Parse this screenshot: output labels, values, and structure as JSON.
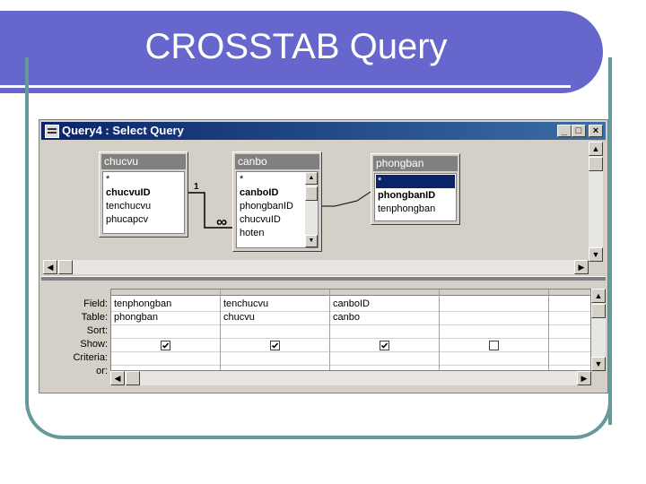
{
  "slide": {
    "title": "CROSSTAB Query"
  },
  "window": {
    "title": "Query4 : Select Query",
    "buttons": {
      "minimize": "_",
      "maximize": "□",
      "close": "×"
    }
  },
  "tables": [
    {
      "name": "chucvu",
      "fields": [
        "*",
        "chucvuID",
        "tenchucvu",
        "phucapcv"
      ],
      "bold_fields": [
        "chucvuID"
      ]
    },
    {
      "name": "canbo",
      "fields": [
        "*",
        "canboID",
        "phongbanID",
        "chucvuID",
        "hoten"
      ],
      "bold_fields": [
        "canboID"
      ]
    },
    {
      "name": "phongban",
      "fields": [
        "*",
        "phongbanID",
        "tenphongban"
      ],
      "bold_fields": [
        "phongbanID"
      ],
      "selected_field": "*"
    }
  ],
  "relationship": {
    "one_side": "1",
    "many_side": "∞"
  },
  "grid": {
    "row_labels": [
      "Field:",
      "Table:",
      "Sort:",
      "Show:",
      "Criteria:",
      "or:"
    ],
    "columns": [
      {
        "field": "tenphongban",
        "table": "phongban",
        "sort": "",
        "show": true,
        "criteria": ""
      },
      {
        "field": "tenchucvu",
        "table": "chucvu",
        "sort": "",
        "show": true,
        "criteria": ""
      },
      {
        "field": "canboID",
        "table": "canbo",
        "sort": "",
        "show": true,
        "criteria": ""
      },
      {
        "field": "",
        "table": "",
        "sort": "",
        "show": false,
        "criteria": ""
      },
      {
        "field": "",
        "table": "",
        "sort": "",
        "show": false,
        "criteria": ""
      }
    ]
  },
  "colors": {
    "slide_accent": "#6666cc",
    "frame": "#669999",
    "titlebar": "#0a246a",
    "selection": "#0a246a"
  }
}
